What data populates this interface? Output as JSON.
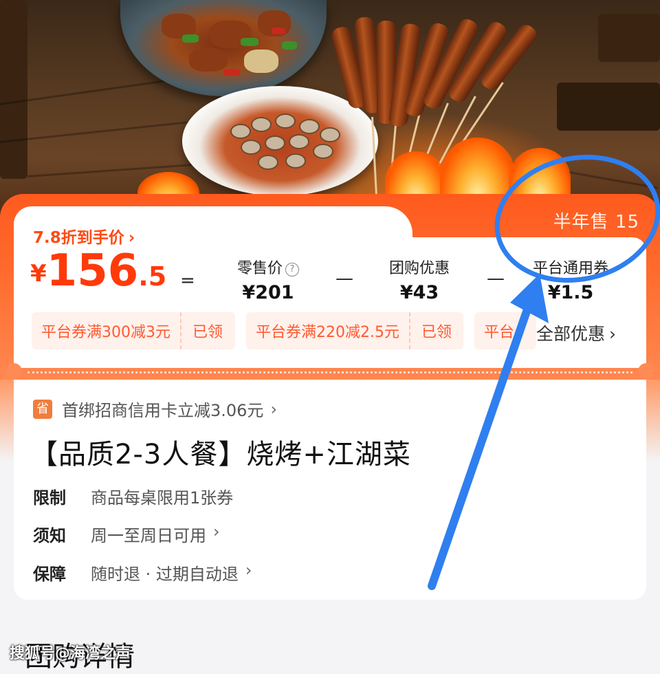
{
  "hero": {
    "description_icon": "food-photo"
  },
  "price": {
    "sales_text": "半年售 15",
    "discount_text": "7.8折到手价",
    "currency": "¥",
    "final_int": "156",
    "final_dec": ".5",
    "equals": "=",
    "minus": "—",
    "retail_label": "零售价",
    "retail_value": "¥201",
    "group_label": "团购优惠",
    "group_value": "¥43",
    "platform_label": "平台通用券",
    "platform_value": "¥1.5"
  },
  "coupons": [
    {
      "text": "平台券满300减3元",
      "status": "已领"
    },
    {
      "text": "平台券满220减2.5元",
      "status": "已领"
    },
    {
      "text": "平台"
    }
  ],
  "all_offers": "全部优惠",
  "bank_offer": "首绑招商信用卡立减3.06元",
  "bank_icon_char": "省",
  "product_title": "【品质2-3人餐】烧烤+江湖菜",
  "info": [
    {
      "key": "限制",
      "value": "商品每桌限用1张券"
    },
    {
      "key": "须知",
      "value": "周一至周日可用"
    },
    {
      "key": "保障",
      "value": "随时退 · 过期自动退"
    }
  ],
  "section_title": "团购详情",
  "watermark": "搜狐号@海湾之声",
  "colors": {
    "accent": "#ff4a12",
    "annotation": "#2f7ff0"
  }
}
